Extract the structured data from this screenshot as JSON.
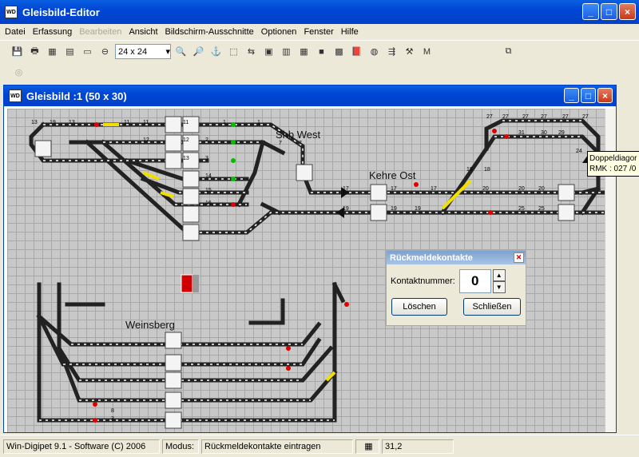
{
  "app": {
    "title": "Gleisbild-Editor",
    "icon": "digipet-app-icon"
  },
  "menu": [
    {
      "label": "Datei",
      "disabled": false
    },
    {
      "label": "Erfassung",
      "disabled": false
    },
    {
      "label": "Bearbeiten",
      "disabled": true
    },
    {
      "label": "Ansicht",
      "disabled": false
    },
    {
      "label": "Bildschirm-Ausschnitte",
      "disabled": false
    },
    {
      "label": "Optionen",
      "disabled": false
    },
    {
      "label": "Fenster",
      "disabled": false
    },
    {
      "label": "Hilfe",
      "disabled": false
    }
  ],
  "toolbar": {
    "zoom_value": "24 x 24",
    "m_label": "M"
  },
  "child": {
    "title": "Gleisbild :1 (50 x 30)"
  },
  "layout_labels": {
    "shb_west": "Shb West",
    "kehre_ost": "Kehre Ost",
    "weinsberg": "Weinsberg"
  },
  "tooltip": {
    "line1": "Doppeldiagor",
    "line2": "RMK : 027 /0"
  },
  "dialog": {
    "title": "Rückmeldekontakte",
    "field_label": "Kontaktnummer:",
    "value": "0",
    "delete_label": "Löschen",
    "close_label": "Schließen"
  },
  "status": {
    "product": "Win-Digipet 9.1 - Software (C) 2006",
    "mode_label": "Modus:",
    "mode_value": "Rückmeldekontakte eintragen",
    "coords": "31,2"
  },
  "colors": {
    "track": "#222222",
    "track_dash": "#ffffff",
    "highlight_yellow": "#f0e000",
    "signal_red": "#e00000",
    "signal_green": "#00c000"
  }
}
